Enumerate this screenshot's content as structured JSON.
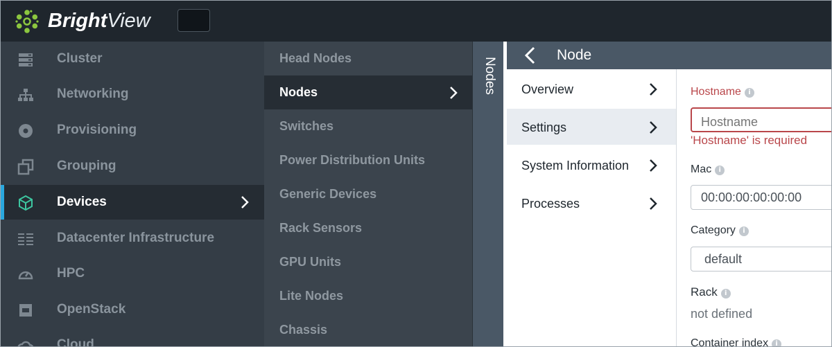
{
  "app": {
    "brand_bold": "Bright",
    "brand_light": "View"
  },
  "sidebar": {
    "items": [
      {
        "label": "Cluster",
        "icon": "server-stack-icon"
      },
      {
        "label": "Networking",
        "icon": "network-tree-icon"
      },
      {
        "label": "Provisioning",
        "icon": "disc-icon"
      },
      {
        "label": "Grouping",
        "icon": "group-squares-icon"
      },
      {
        "label": "Devices",
        "icon": "cube-icon",
        "active": true
      },
      {
        "label": "Datacenter Infrastructure",
        "icon": "rack-rows-icon"
      },
      {
        "label": "HPC",
        "icon": "gauge-icon"
      },
      {
        "label": "OpenStack",
        "icon": "openstack-icon"
      },
      {
        "label": "Cloud",
        "icon": "cloud-icon"
      }
    ]
  },
  "subnav": {
    "items": [
      {
        "label": "Head Nodes"
      },
      {
        "label": "Nodes",
        "active": true
      },
      {
        "label": "Switches"
      },
      {
        "label": "Power Distribution Units"
      },
      {
        "label": "Generic Devices"
      },
      {
        "label": "Rack Sensors"
      },
      {
        "label": "GPU Units"
      },
      {
        "label": "Lite Nodes"
      },
      {
        "label": "Chassis"
      }
    ]
  },
  "vertical_tab": {
    "label": "Nodes"
  },
  "content": {
    "title": "Node",
    "menu": [
      {
        "label": "Overview"
      },
      {
        "label": "Settings",
        "active": true
      },
      {
        "label": "System Information"
      },
      {
        "label": "Processes"
      }
    ],
    "form": {
      "hostname_label": "Hostname",
      "hostname_placeholder": "Hostname",
      "hostname_error": "'Hostname' is required",
      "mac_label": "Mac",
      "mac_value": "00:00:00:00:00:00",
      "category_label": "Category",
      "category_value": "default",
      "rack_label": "Rack",
      "rack_value": "not defined",
      "container_index_label": "Container index"
    }
  },
  "colors": {
    "accent": "#2aa8de",
    "error": "#b9464a",
    "logo_green": "#8cc63f",
    "header_dark": "#1f262d"
  }
}
